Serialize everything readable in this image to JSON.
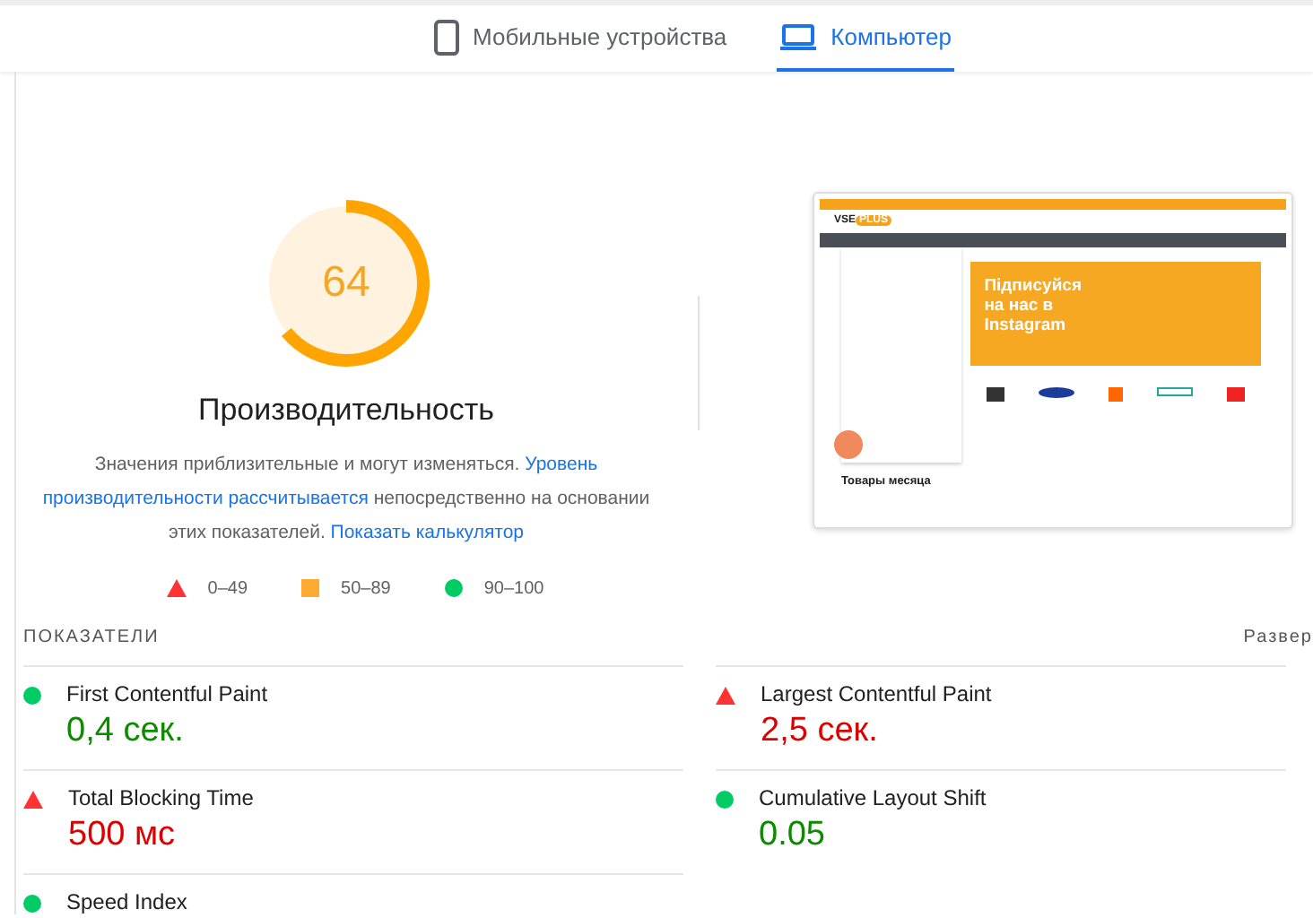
{
  "tabs": [
    {
      "label": "Мобильные устройства",
      "kind": "phone",
      "selected": false
    },
    {
      "label": "Компьютер",
      "kind": "laptop",
      "selected": true
    }
  ],
  "score": {
    "value": "64",
    "level": 0.64,
    "title": "Производительность"
  },
  "description": [
    {
      "kind": "text",
      "text": "Значения приблизительные и могут изменяться. "
    },
    {
      "kind": "link",
      "text": "Уровень"
    },
    {
      "kind": "link",
      "text": "производительности рассчитывается"
    },
    {
      "kind": "text",
      "text": " непосредственно на основании этих показателей. "
    },
    {
      "kind": "link",
      "text": "Показать калькулятор"
    }
  ],
  "legend": [
    {
      "kind": "bad",
      "label": "0–49"
    },
    {
      "kind": "average",
      "label": "50–89"
    },
    {
      "kind": "good",
      "label": "90–100"
    }
  ],
  "preview": {
    "logo": [
      "VSE",
      "PLUS"
    ],
    "banner": "Підписуйся на нас в Instagram",
    "section": "Товары месяца"
  },
  "metrics_header": {
    "title": "ПОКАЗАТЕЛИ",
    "toggle": "Развер"
  },
  "metrics": [
    {
      "name": "First Contentful Paint",
      "value": "0,4 сек.",
      "kind": "good"
    },
    {
      "name": "Largest Contentful Paint",
      "value": "2,5 сек.",
      "kind": "bad"
    },
    {
      "name": "Total Blocking Time",
      "value": "500 мс",
      "kind": "bad"
    },
    {
      "name": "Cumulative Layout Shift",
      "value": "0.05",
      "kind": "good"
    },
    {
      "name": "Speed Index",
      "kind": "good"
    }
  ]
}
